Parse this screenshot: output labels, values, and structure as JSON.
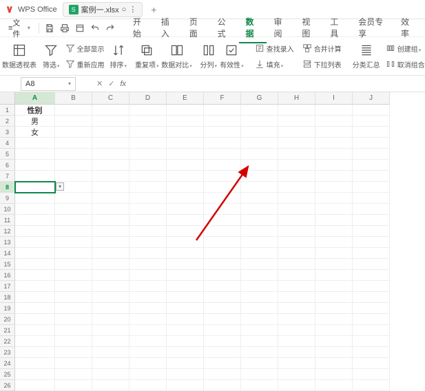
{
  "titlebar": {
    "app_name": "WPS Office",
    "file_tab": {
      "icon_letter": "S",
      "name": "案例一.xlsx"
    }
  },
  "menubar": {
    "file_btn": "文件",
    "tabs": [
      "开始",
      "插入",
      "页面",
      "公式",
      "数据",
      "审阅",
      "视图",
      "工具",
      "会员专享",
      "效率"
    ],
    "active_tab": "数据"
  },
  "ribbon": {
    "pivot": "数据透视表",
    "filter": "筛选",
    "clear_all": "全部显示",
    "reapply": "重新应用",
    "sort": "排序",
    "dedup": "重复项",
    "compare": "数据对比",
    "split": "分列",
    "validation": "有效性",
    "find_input": "查找录入",
    "fill": "填充",
    "merge_calc": "合并计算",
    "dropdown_list": "下拉列表",
    "subtotal": "分类汇总",
    "group": "创建组",
    "ungroup": "取消组合"
  },
  "formula_bar": {
    "name_box": "A8",
    "fx": "fx"
  },
  "grid": {
    "columns": [
      "A",
      "B",
      "C",
      "D",
      "E",
      "F",
      "G",
      "H",
      "I",
      "J"
    ],
    "active_col": "A",
    "active_row": 8,
    "cells": {
      "A1": "性别",
      "A2": "男",
      "A3": "女"
    },
    "row_count": 26
  }
}
